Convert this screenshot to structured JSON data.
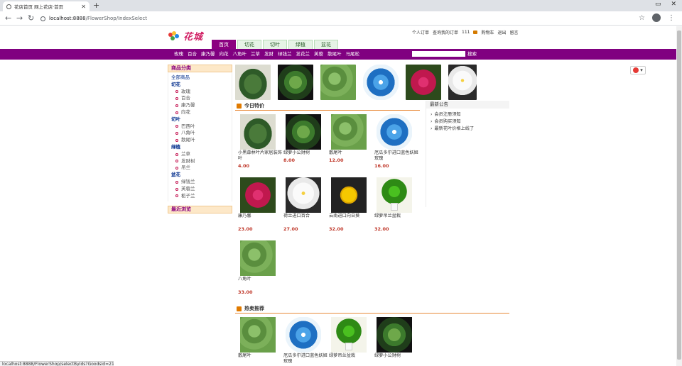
{
  "browser": {
    "tab_title": "花店首页 网上花店·首页",
    "url_host": "localhost:8888",
    "url_path": "/FlowerShop/IndexSelect",
    "status_url": "localhost:8888/FlowerShop/selectByIds?GoodsId=21"
  },
  "header": {
    "logo_text": "花城",
    "user_links": [
      "个人订单",
      "查询我的订单",
      "111",
      "购物车",
      "退出",
      "留言"
    ],
    "cat_tabs": [
      "首页",
      "切花",
      "切叶",
      "绿植",
      "盆花"
    ]
  },
  "menubar": {
    "items": [
      "玫瑰",
      "百合",
      "康乃馨",
      "向花",
      "八角叶",
      "兰草",
      "发财",
      "绿钱兰",
      "发花兰",
      "芙蓉",
      "散尾叶",
      "马尾松"
    ],
    "search_button": "搜索"
  },
  "sidebar": {
    "title": "商品分类",
    "all": "全部商品",
    "groups": [
      {
        "name": "切花",
        "items": [
          "玫瑰",
          "百合",
          "康乃馨",
          "向花"
        ]
      },
      {
        "name": "切叶",
        "items": [
          "巴西叶",
          "八角叶",
          "散尾叶"
        ]
      },
      {
        "name": "绿植",
        "items": [
          "兰草",
          "发财树",
          "吊兰"
        ]
      },
      {
        "name": "盆花",
        "items": [
          "绿钱兰",
          "芙蓉兰",
          "栀子兰"
        ]
      }
    ],
    "recent_title": "最近浏览"
  },
  "today": {
    "title": "今日特价",
    "products": [
      {
        "name": "小黑森林叶片家居装饰叶",
        "price": "4.00",
        "img": "leaf"
      },
      {
        "name": "绿萝小公财树",
        "price": "8.00",
        "img": "leaf2"
      },
      {
        "name": "散尾叶",
        "price": "12.00",
        "img": "herb"
      },
      {
        "name": "厄瓜多尔进口蓝色妖姬玫瑰",
        "price": "16.00",
        "img": "blue"
      },
      {
        "name": "康乃馨",
        "price": "23.00",
        "img": "peony"
      },
      {
        "name": "荷兰进口百合",
        "price": "27.00",
        "img": "lily"
      },
      {
        "name": "云南进口向日葵",
        "price": "32.00",
        "img": "sunflower"
      },
      {
        "name": "绿萝吊兰盆栽",
        "price": "32.00",
        "img": "pothos"
      },
      {
        "name": "八角叶",
        "price": "33.00",
        "img": "herb"
      }
    ]
  },
  "news": {
    "title": "最新公告",
    "items": [
      "会员注册须知",
      "会员购买须知",
      "最新花叶价格上线了"
    ]
  },
  "hot": {
    "title": "热卖推荐",
    "products": [
      {
        "name": "散尾叶",
        "img": "herb"
      },
      {
        "name": "厄瓜多尔进口蓝色妖姬玫瑰",
        "img": "blue"
      },
      {
        "name": "绿萝吊兰盆栽",
        "img": "pothos"
      },
      {
        "name": "绿萝小公财树",
        "img": "leaf2"
      }
    ]
  },
  "strip": [
    "leaf",
    "leaf2",
    "herb",
    "blue",
    "peony",
    "lily"
  ],
  "colors": {
    "brand": "#800080",
    "price": "#c0392b",
    "accent": "#e88a3a"
  }
}
